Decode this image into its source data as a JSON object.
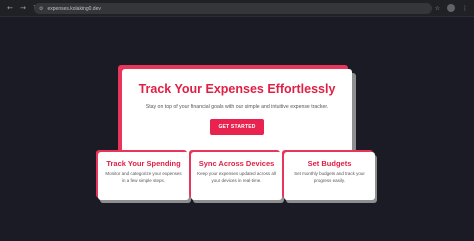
{
  "browser": {
    "back_icon": "arrow-left",
    "forward_icon": "arrow-right",
    "reload_icon": "reload",
    "url": "expenses.kolaking0.dev",
    "bookmark_icon": "star",
    "menu_icon": "vertical-dots"
  },
  "hero": {
    "title": "Track Your Expenses Effortlessly",
    "subtitle": "Stay on top of your financial goals with our simple and intuitive expense tracker.",
    "cta_label": "GET STARTED"
  },
  "features": [
    {
      "title": "Track Your Spending",
      "body": "Monitor and categorize your expenses in a few simple steps."
    },
    {
      "title": "Sync Across Devices",
      "body": "Keep your expenses updated across all your devices in real-time."
    },
    {
      "title": "Set Budgets",
      "body": "Set monthly budgets and track your progress easily."
    }
  ],
  "colors": {
    "accent": "#e01f45",
    "background": "#1b1b26",
    "card": "#ffffff"
  }
}
